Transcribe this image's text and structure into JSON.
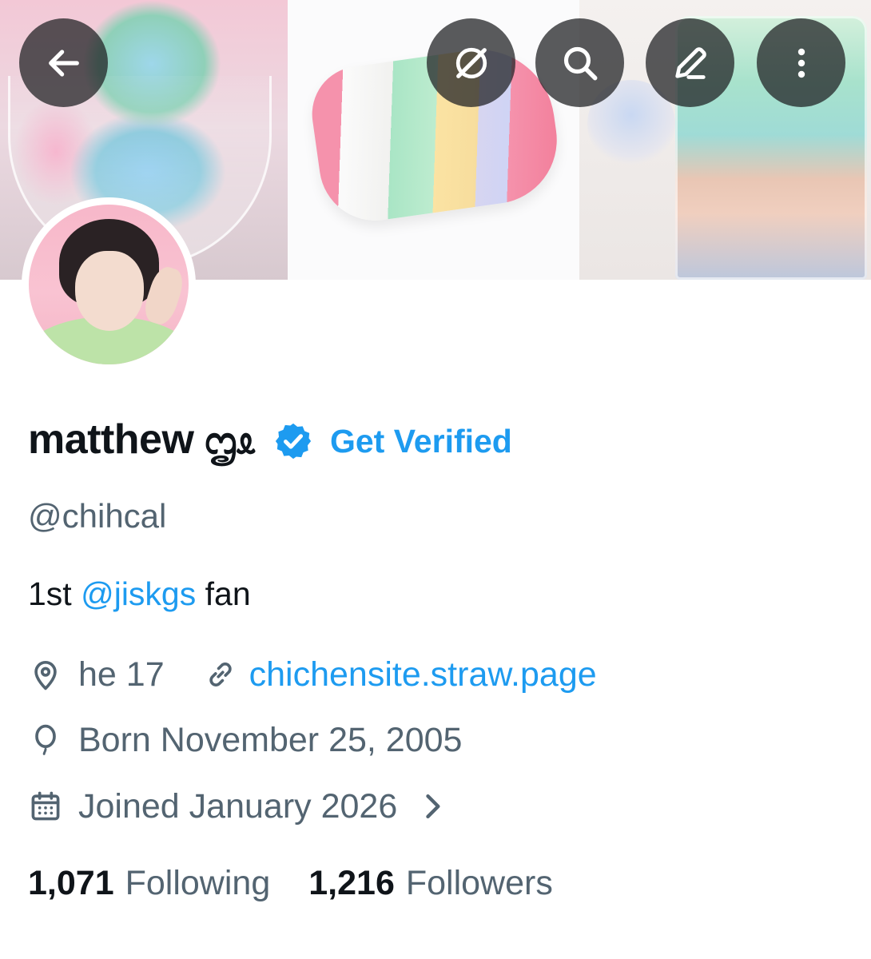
{
  "header": {
    "back_icon": "arrow-left-icon",
    "grok_icon": "grok-icon",
    "search_icon": "search-icon",
    "edit_icon": "pencil-icon",
    "more_icon": "more-vertical-icon"
  },
  "profile": {
    "display_name": "matthew ᦗᦸ",
    "verified_badge": "verified-icon",
    "get_verified_label": "Get Verified",
    "handle": "@chihcal",
    "bio": {
      "prefix": "1st ",
      "mention": "@jiskgs",
      "suffix": " fan"
    },
    "location": "he 17",
    "website": "chichensite.straw.page",
    "birthday": "Born November 25, 2005",
    "joined": "Joined January 2026",
    "following_count": "1,071",
    "following_label": "Following",
    "followers_count": "1,216",
    "followers_label": "Followers"
  },
  "colors": {
    "accent": "#1d9bf0",
    "text_primary": "#0f1419",
    "text_secondary": "#536471",
    "overlay_button": "#202224"
  }
}
